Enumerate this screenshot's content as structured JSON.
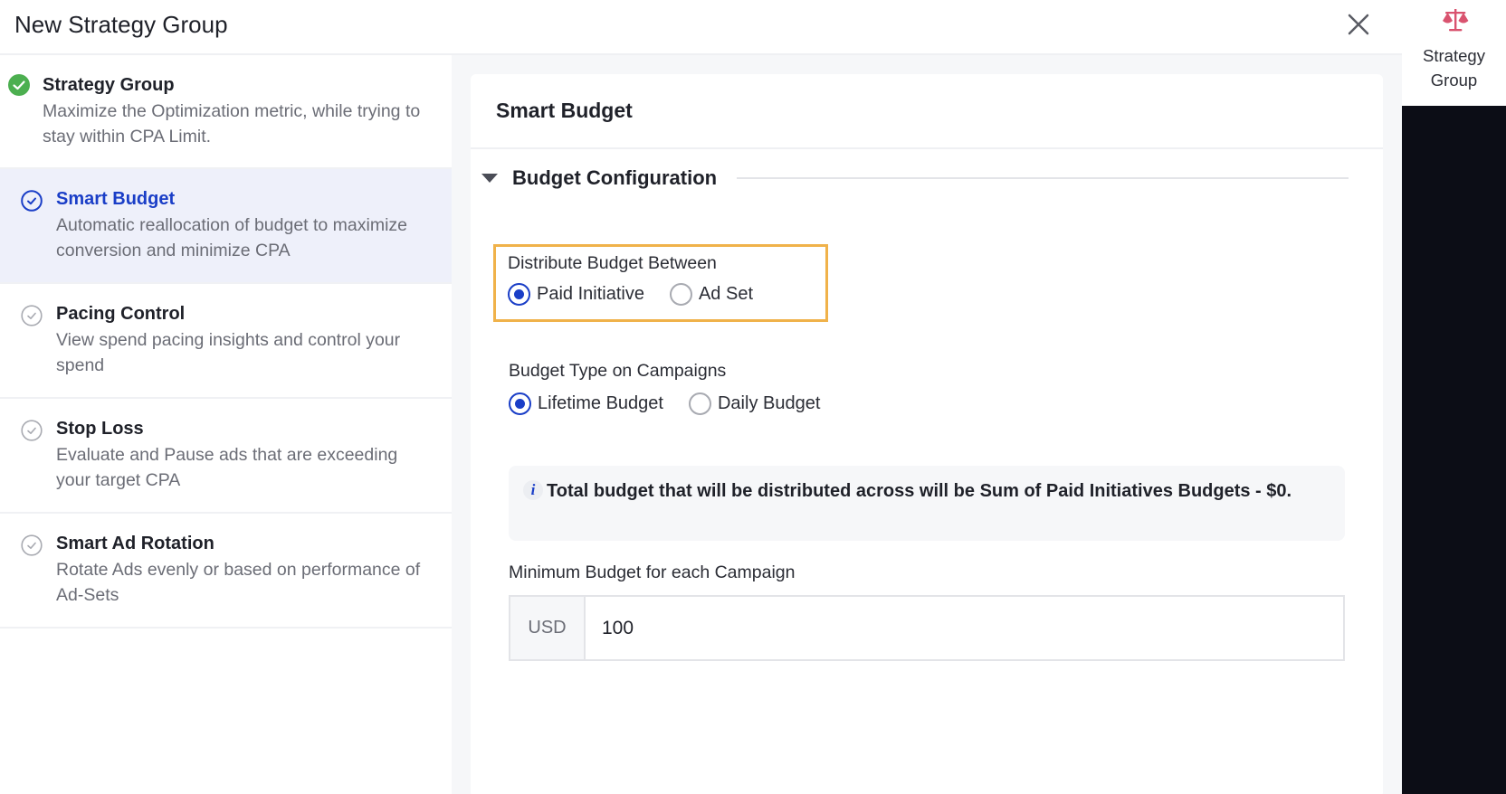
{
  "header": {
    "title": "New Strategy Group",
    "close_icon": "close-icon"
  },
  "steps": [
    {
      "title": "Strategy Group",
      "description": "Maximize the Optimization metric, while trying to stay within CPA Limit.",
      "status": "completed",
      "icon": "check-circle-filled-icon"
    },
    {
      "title": "Smart Budget",
      "description": "Automatic reallocation of budget to maximize conversion and minimize CPA",
      "status": "active",
      "icon": "check-circle-outline-icon"
    },
    {
      "title": "Pacing Control",
      "description": "View spend pacing insights and control your spend",
      "status": "pending",
      "icon": "check-circle-outline-icon"
    },
    {
      "title": "Stop Loss",
      "description": "Evaluate and Pause ads that are exceeding your target CPA",
      "status": "pending",
      "icon": "check-circle-outline-icon"
    },
    {
      "title": "Smart Ad Rotation",
      "description": "Rotate Ads evenly or based on performance of Ad-Sets",
      "status": "pending",
      "icon": "check-circle-outline-icon"
    }
  ],
  "card": {
    "title": "Smart Budget",
    "section_title": "Budget Configuration",
    "distribute": {
      "label": "Distribute Budget Between",
      "options": [
        "Paid Initiative",
        "Ad Set"
      ],
      "selected": "Paid Initiative"
    },
    "budget_type": {
      "label": "Budget Type on Campaigns",
      "options": [
        "Lifetime Budget",
        "Daily Budget"
      ],
      "selected": "Lifetime Budget"
    },
    "info": {
      "icon": "i",
      "text": "Total budget that will be distributed across will be Sum of Paid Initiatives Budgets - $0."
    },
    "min_budget": {
      "label": "Minimum Budget for each Campaign",
      "currency": "USD",
      "value": "100"
    }
  },
  "rail": {
    "item_label": "Strategy Group",
    "icon": "scale-icon"
  },
  "colors": {
    "accent": "#1a3ec7",
    "success": "#4caf50",
    "highlight": "#f0b24a",
    "rail_icon": "#d9536f",
    "dark_panel": "#0c0d16"
  }
}
